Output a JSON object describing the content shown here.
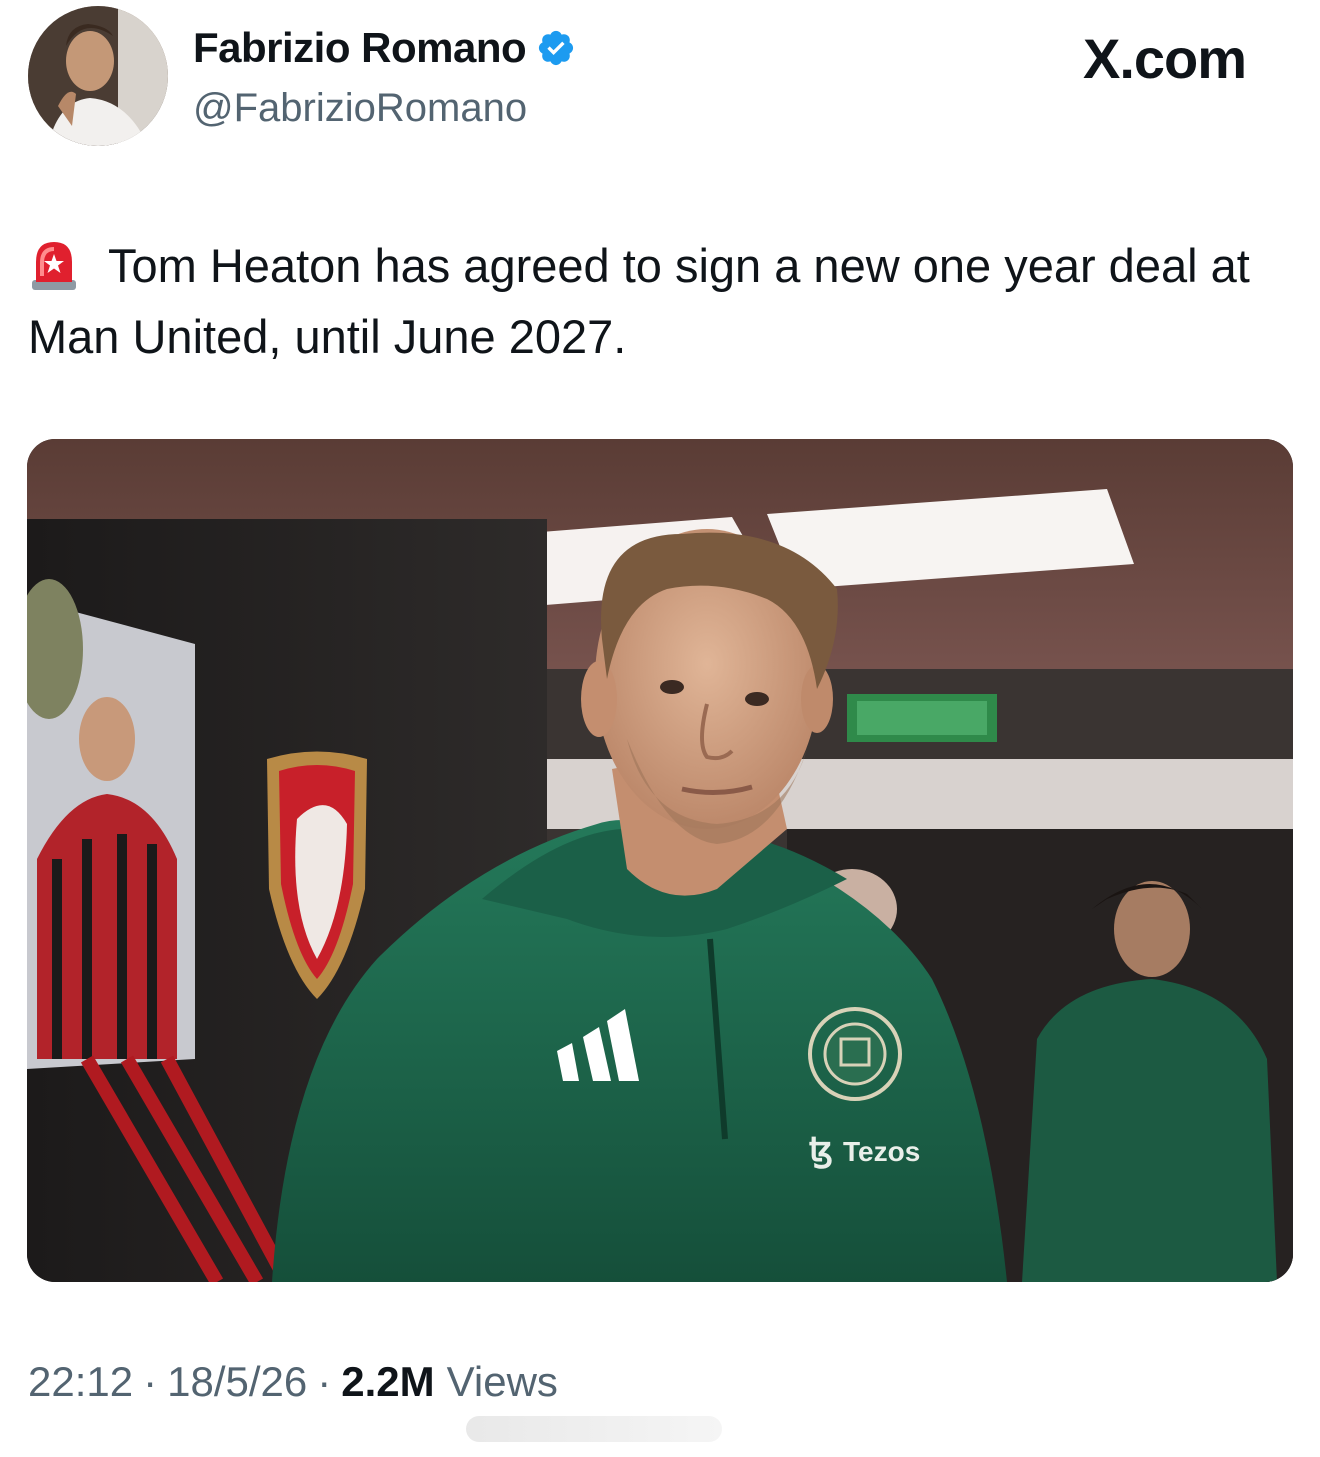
{
  "author": {
    "display_name": "Fabrizio Romano",
    "handle": "@FabrizioRomano",
    "verified": true,
    "avatar_icon": "profile-photo"
  },
  "brand": {
    "label": "X.com"
  },
  "tweet": {
    "emoji_icon": "rotating-light-icon",
    "text": "Tom Heaton has agreed to sign a new one year deal at Man United, until June 2027."
  },
  "media": {
    "sponsor_text": "Tezos"
  },
  "meta": {
    "time": "22:12",
    "date": "18/5/26",
    "views_count": "2.2M",
    "views_label": "Views",
    "separator": "·"
  },
  "colors": {
    "text_primary": "#0f1419",
    "text_secondary": "#536471",
    "verified_blue": "#1d9bf0",
    "jersey_green": "#1f6b4a"
  }
}
